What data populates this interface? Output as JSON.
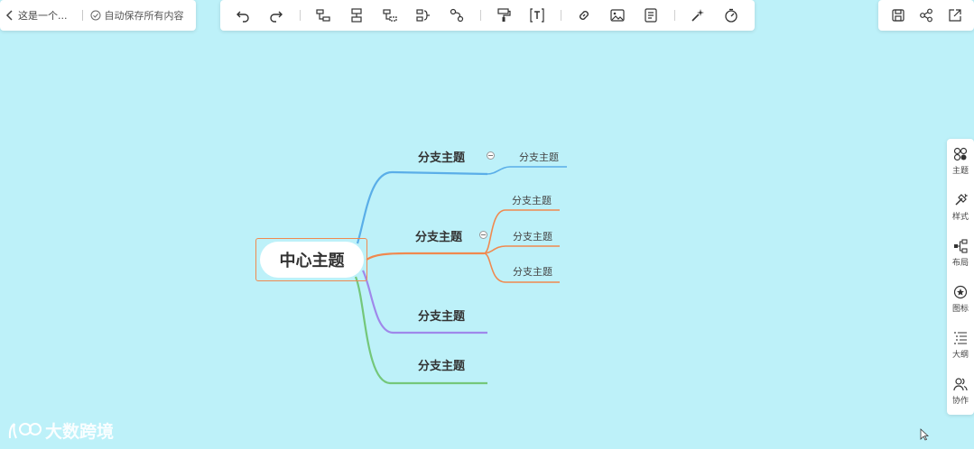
{
  "header": {
    "title": "这是一个...",
    "autosave_text": "自动保存所有内容"
  },
  "toolbar": {
    "buttons": [
      {
        "name": "undo-icon"
      },
      {
        "name": "redo-icon"
      },
      {
        "name": "add-child-topic-icon"
      },
      {
        "name": "add-sibling-topic-icon"
      },
      {
        "name": "add-parent-topic-icon"
      },
      {
        "name": "summary-icon"
      },
      {
        "name": "relationship-icon"
      },
      {
        "name": "format-painter-icon"
      },
      {
        "name": "text-icon"
      },
      {
        "name": "link-icon"
      },
      {
        "name": "image-icon"
      },
      {
        "name": "note-icon"
      },
      {
        "name": "magic-icon"
      },
      {
        "name": "timer-icon"
      }
    ]
  },
  "top_right": {
    "buttons": [
      "save-icon",
      "share-icon",
      "export-icon"
    ]
  },
  "sidebar": {
    "items": [
      {
        "label": "主题",
        "icon": "theme-icon"
      },
      {
        "label": "样式",
        "icon": "style-icon"
      },
      {
        "label": "布局",
        "icon": "layout-icon"
      },
      {
        "label": "图标",
        "icon": "icon-set-icon"
      },
      {
        "label": "大纲",
        "icon": "outline-icon"
      },
      {
        "label": "协作",
        "icon": "collaborate-icon"
      }
    ]
  },
  "mindmap": {
    "central": "中心主题",
    "branches": [
      {
        "label": "分支主题",
        "color": "#5aaee8",
        "children": [
          "分支主题"
        ]
      },
      {
        "label": "分支主题",
        "color": "#f0894f",
        "children": [
          "分支主题",
          "分支主题",
          "分支主题"
        ]
      },
      {
        "label": "分支主题",
        "color": "#9f88ea",
        "children": []
      },
      {
        "label": "分支主题",
        "color": "#74c77a",
        "children": []
      }
    ]
  },
  "watermark": {
    "text": "大数跨境"
  },
  "colors": {
    "canvas_bg": "#bdf1f9",
    "central_border": "#f08a50"
  }
}
